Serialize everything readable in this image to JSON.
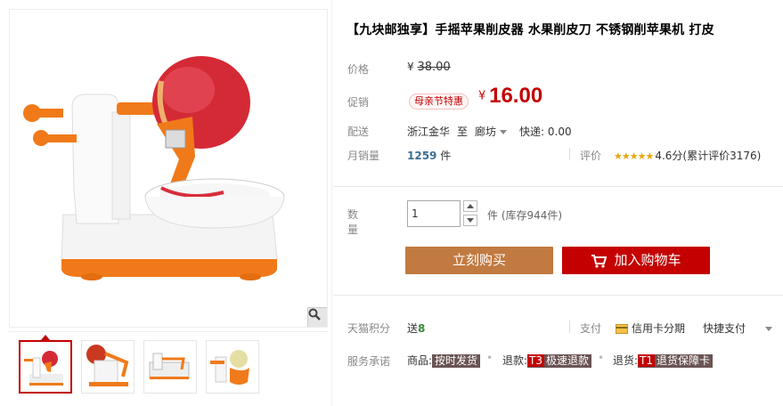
{
  "product": {
    "title": "【九块邮独享】手摇苹果削皮器 水果削皮刀 不锈钢削苹果机 打皮"
  },
  "price": {
    "label": "价格",
    "currency": "¥",
    "original": "38.00"
  },
  "promotion": {
    "label": "促销",
    "tag": "母亲节特惠",
    "currency": "¥",
    "price": "16.00"
  },
  "shipping": {
    "label": "配送",
    "from": "浙江金华",
    "to_word": "至",
    "destination": "廊坊",
    "express": "快递: 0.00"
  },
  "sales": {
    "label": "月销量",
    "count": "1259",
    "unit": "件"
  },
  "rating": {
    "label": "评价",
    "stars": "★★★★★",
    "text": "4.6分(累计评价3176)"
  },
  "quantity": {
    "label": "数量",
    "value": "1",
    "unit_stock": "件 (库存944件)"
  },
  "actions": {
    "buy_now": "立刻购买",
    "add_cart": "加入购物车"
  },
  "points": {
    "label": "天猫积分",
    "send": "送",
    "value": "8",
    "pay_label": "支付",
    "credit": "信用卡分期",
    "quick_pay": "快捷支付"
  },
  "service": {
    "label": "服务承诺",
    "goods_label": "商品:",
    "goods_badge": "按时发货",
    "refund_label": "退款:",
    "refund_code": "T3",
    "refund_badge": "极速退款",
    "return_label": "退货:",
    "return_code": "T1",
    "return_badge": "退货保障卡"
  },
  "colors": {
    "accent": "#c40000",
    "buy_now": "#c17a40",
    "sales_count": "#3c6e93",
    "stars": "#e8a50c"
  }
}
